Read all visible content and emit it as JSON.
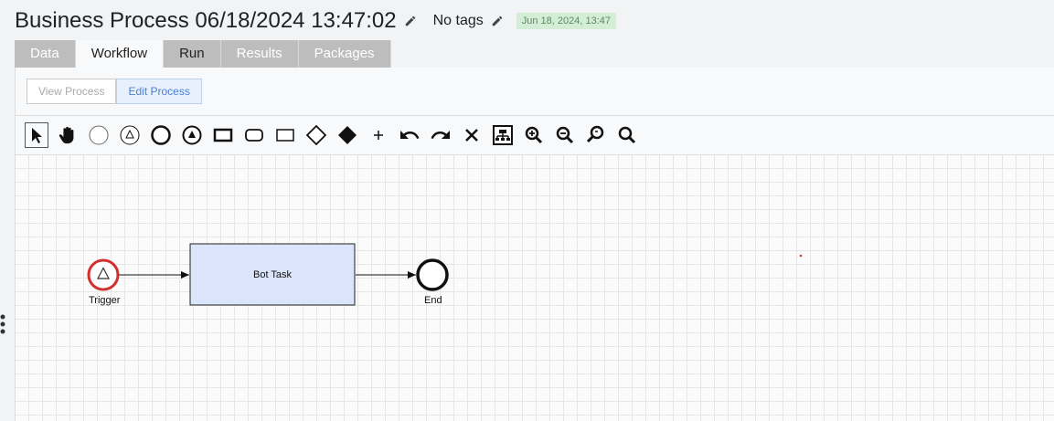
{
  "header": {
    "title": "Business Process 06/18/2024 13:47:02",
    "tags": "No tags",
    "date_badge": "Jun 18, 2024, 13:47"
  },
  "tabs": [
    {
      "label": "Data"
    },
    {
      "label": "Workflow"
    },
    {
      "label": "Run"
    },
    {
      "label": "Results"
    },
    {
      "label": "Packages"
    }
  ],
  "mode": {
    "view": "View Process",
    "edit": "Edit Process"
  },
  "toolbar": {
    "icons": [
      "pointer-icon",
      "hand-icon",
      "start-event-icon",
      "start-trigger-icon",
      "end-event-icon",
      "end-trigger-icon",
      "task-icon",
      "subprocess-icon",
      "rectangle-icon",
      "gateway-icon",
      "gateway-filled-icon",
      "add-icon",
      "undo-icon",
      "redo-icon",
      "delete-icon",
      "layout-icon",
      "zoom-in-icon",
      "zoom-out-icon",
      "zoom-reset-icon",
      "zoom-fit-icon"
    ]
  },
  "diagram": {
    "trigger_label": "Trigger",
    "task_label": "Bot Task",
    "end_label": "End",
    "colors": {
      "trigger": "#d32f2f",
      "task_fill": "#dae4fa"
    }
  }
}
